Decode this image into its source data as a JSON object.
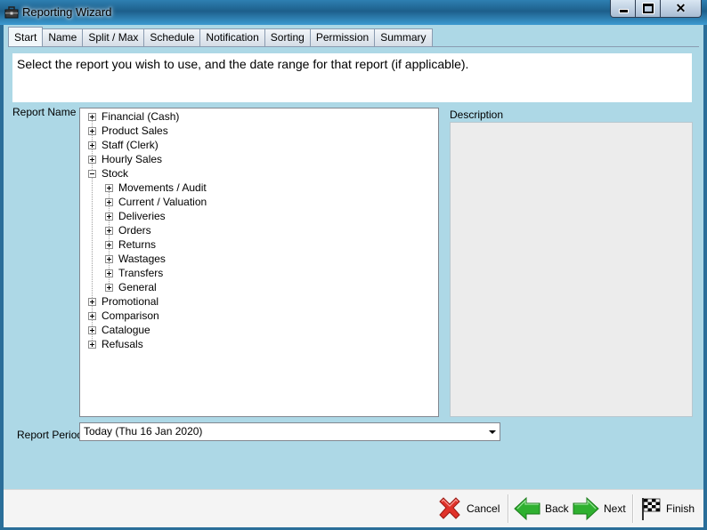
{
  "window": {
    "title": "Reporting Wizard",
    "controls": {
      "close_glyph": "✕"
    }
  },
  "tabs": [
    {
      "label": "Start",
      "active": true
    },
    {
      "label": "Name"
    },
    {
      "label": "Split / Max"
    },
    {
      "label": "Schedule"
    },
    {
      "label": "Notification"
    },
    {
      "label": "Sorting"
    },
    {
      "label": "Permission"
    },
    {
      "label": "Summary"
    }
  ],
  "instruction": "Select the report you wish to use, and the date range for that report (if applicable).",
  "report_name": {
    "label": "Report Name",
    "tree": [
      {
        "label": "Financial (Cash)",
        "expanded": false
      },
      {
        "label": "Product Sales",
        "expanded": false
      },
      {
        "label": "Staff (Clerk)",
        "expanded": false
      },
      {
        "label": "Hourly Sales",
        "expanded": false
      },
      {
        "label": "Stock",
        "expanded": true,
        "children": [
          {
            "label": "Movements / Audit"
          },
          {
            "label": "Current / Valuation"
          },
          {
            "label": "Deliveries"
          },
          {
            "label": "Orders"
          },
          {
            "label": "Returns"
          },
          {
            "label": "Wastages"
          },
          {
            "label": "Transfers"
          },
          {
            "label": "General"
          }
        ]
      },
      {
        "label": "Promotional",
        "expanded": false
      },
      {
        "label": "Comparison",
        "expanded": false
      },
      {
        "label": "Catalogue",
        "expanded": false
      },
      {
        "label": "Refusals",
        "expanded": false
      }
    ]
  },
  "description": {
    "label": "Description",
    "text": ""
  },
  "report_period": {
    "label": "Report Period",
    "selected": "Today (Thu 16 Jan 2020)"
  },
  "footer": {
    "cancel": "Cancel",
    "back": "Back",
    "next": "Next",
    "finish": "Finish"
  },
  "icons": {
    "app": "toolbox-icon",
    "cancel": "red-x-icon",
    "back": "green-left-arrow-icon",
    "next": "green-right-arrow-icon",
    "finish": "checkered-flag-icon"
  },
  "colors": {
    "client_bg": "#add8e6",
    "titlebar": "#1d5f8b",
    "cancel_red": "#e0322a",
    "arrow_green": "#2fb030"
  }
}
